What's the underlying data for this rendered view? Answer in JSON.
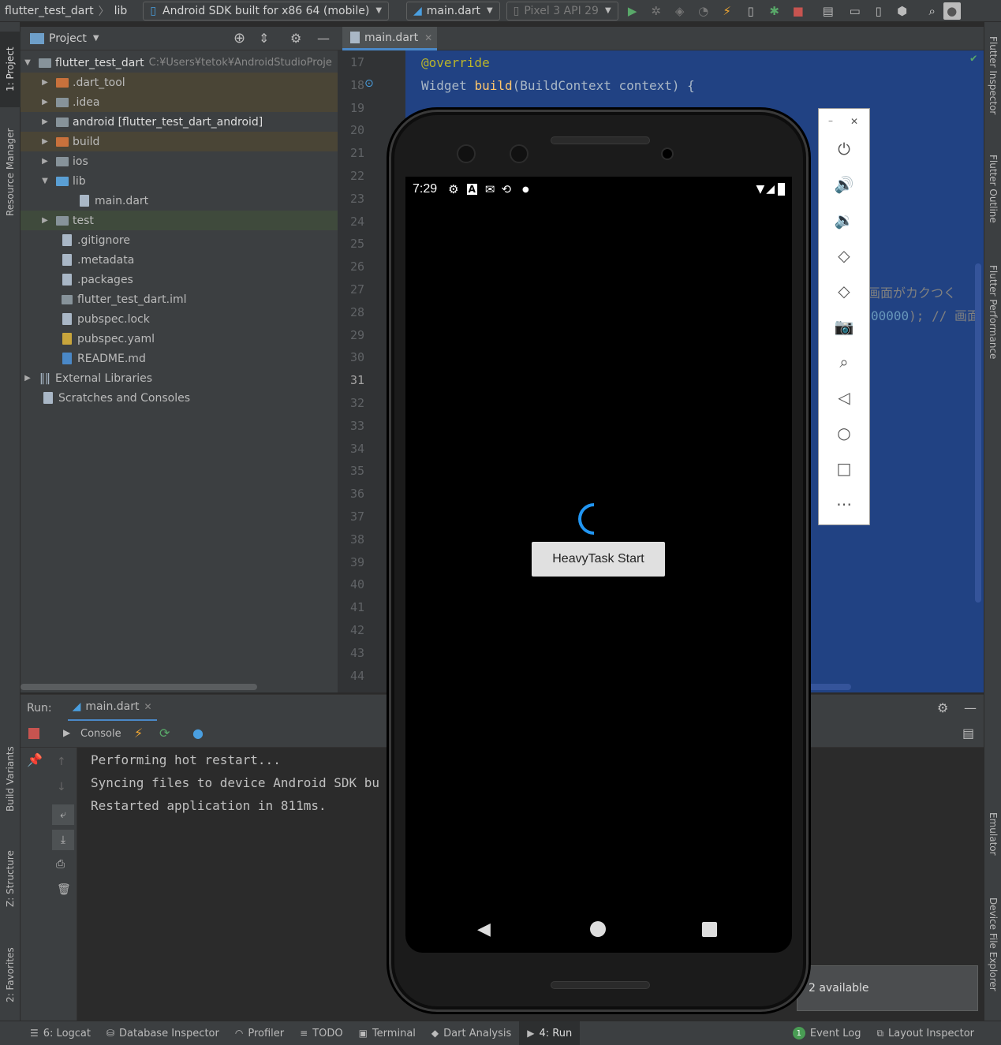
{
  "toolbar": {
    "project": "flutter_test_dart",
    "crumb2": "lib",
    "device_selector": "Android SDK built for x86 64 (mobile)",
    "run_config": "main.dart",
    "avd": "Pixel 3 API 29"
  },
  "left_stripe": {
    "project": "1: Project",
    "resource": "Resource Manager",
    "build_variants": "Build Variants",
    "structure": "Z: Structure",
    "favorites": "2: Favorites"
  },
  "right_stripe": {
    "inspector": "Flutter Inspector",
    "outline": "Flutter Outline",
    "performance": "Flutter Performance",
    "emulator": "Emulator",
    "device_explorer": "Device File Explorer"
  },
  "project_panel": {
    "title": "Project",
    "root": {
      "name": "flutter_test_dart",
      "path": "C:¥Users¥tetok¥AndroidStudioProje"
    },
    "items": [
      {
        "label": ".dart_tool"
      },
      {
        "label": ".idea"
      },
      {
        "label": "android [flutter_test_dart_android]"
      },
      {
        "label": "build"
      },
      {
        "label": "ios"
      },
      {
        "label": "lib"
      },
      {
        "label": "main.dart"
      },
      {
        "label": "test"
      },
      {
        "label": ".gitignore"
      },
      {
        "label": ".metadata"
      },
      {
        "label": ".packages"
      },
      {
        "label": "flutter_test_dart.iml"
      },
      {
        "label": "pubspec.lock"
      },
      {
        "label": "pubspec.yaml"
      },
      {
        "label": "README.md"
      },
      {
        "label": "External Libraries"
      },
      {
        "label": "Scratches and Consoles"
      }
    ]
  },
  "editor": {
    "tab": "main.dart",
    "line_numbers": [
      "17",
      "18",
      "19",
      "20",
      "21",
      "22",
      "23",
      "24",
      "25",
      "26",
      "27",
      "28",
      "29",
      "30",
      "31",
      "32",
      "33",
      "34",
      "35",
      "36",
      "37",
      "38",
      "39",
      "40",
      "41",
      "42",
      "43",
      "44"
    ],
    "code": {
      "l17": "@override",
      "l18_a": "Widget ",
      "l18_fn": "build",
      "l18_b": "(BuildContext context) {",
      "l27_cmt": "画面がカクつく",
      "l28_num": "00000",
      "l28_rest": "); // 画面"
    }
  },
  "run": {
    "label": "Run:",
    "tab": "main.dart",
    "console_tab": "Console",
    "lines": [
      "Performing hot restart...",
      "Syncing files to device Android SDK bu",
      "Restarted application in 811ms."
    ],
    "notification": "2 available"
  },
  "phone": {
    "time": "7:29",
    "button": "HeavyTask Start"
  },
  "bottom_tabs": {
    "logcat": "6: Logcat",
    "db": "Database Inspector",
    "profiler": "Profiler",
    "todo": "TODO",
    "terminal": "Terminal",
    "dart": "Dart Analysis",
    "run": "4: Run",
    "event_count": "1",
    "event": "Event Log",
    "layout": "Layout Inspector"
  }
}
